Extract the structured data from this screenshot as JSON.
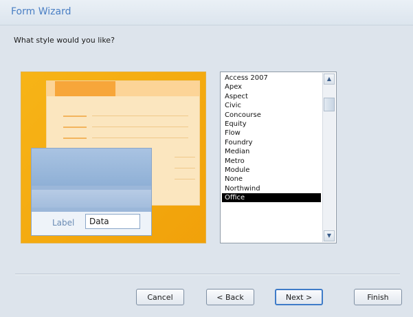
{
  "window": {
    "title": "Form Wizard"
  },
  "prompt": "What style would you like?",
  "preview": {
    "label": "Label",
    "data": "Data"
  },
  "styles": {
    "items": [
      "Access 2007",
      "Apex",
      "Aspect",
      "Civic",
      "Concourse",
      "Equity",
      "Flow",
      "Foundry",
      "Median",
      "Metro",
      "Module",
      "None",
      "Northwind",
      "Office"
    ],
    "selected": "Office"
  },
  "scrollbar": {
    "up_icon": "chevron-up-icon",
    "down_icon": "chevron-down-icon"
  },
  "buttons": {
    "cancel": "Cancel",
    "back": "< Back",
    "next": "Next >",
    "finish": "Finish"
  },
  "colors": {
    "title": "#4a7fc4",
    "preview_background": "#f7b417",
    "preview_accent": "#f7a63a",
    "preview_front": "#9bb7d9",
    "selection": "#000000"
  }
}
